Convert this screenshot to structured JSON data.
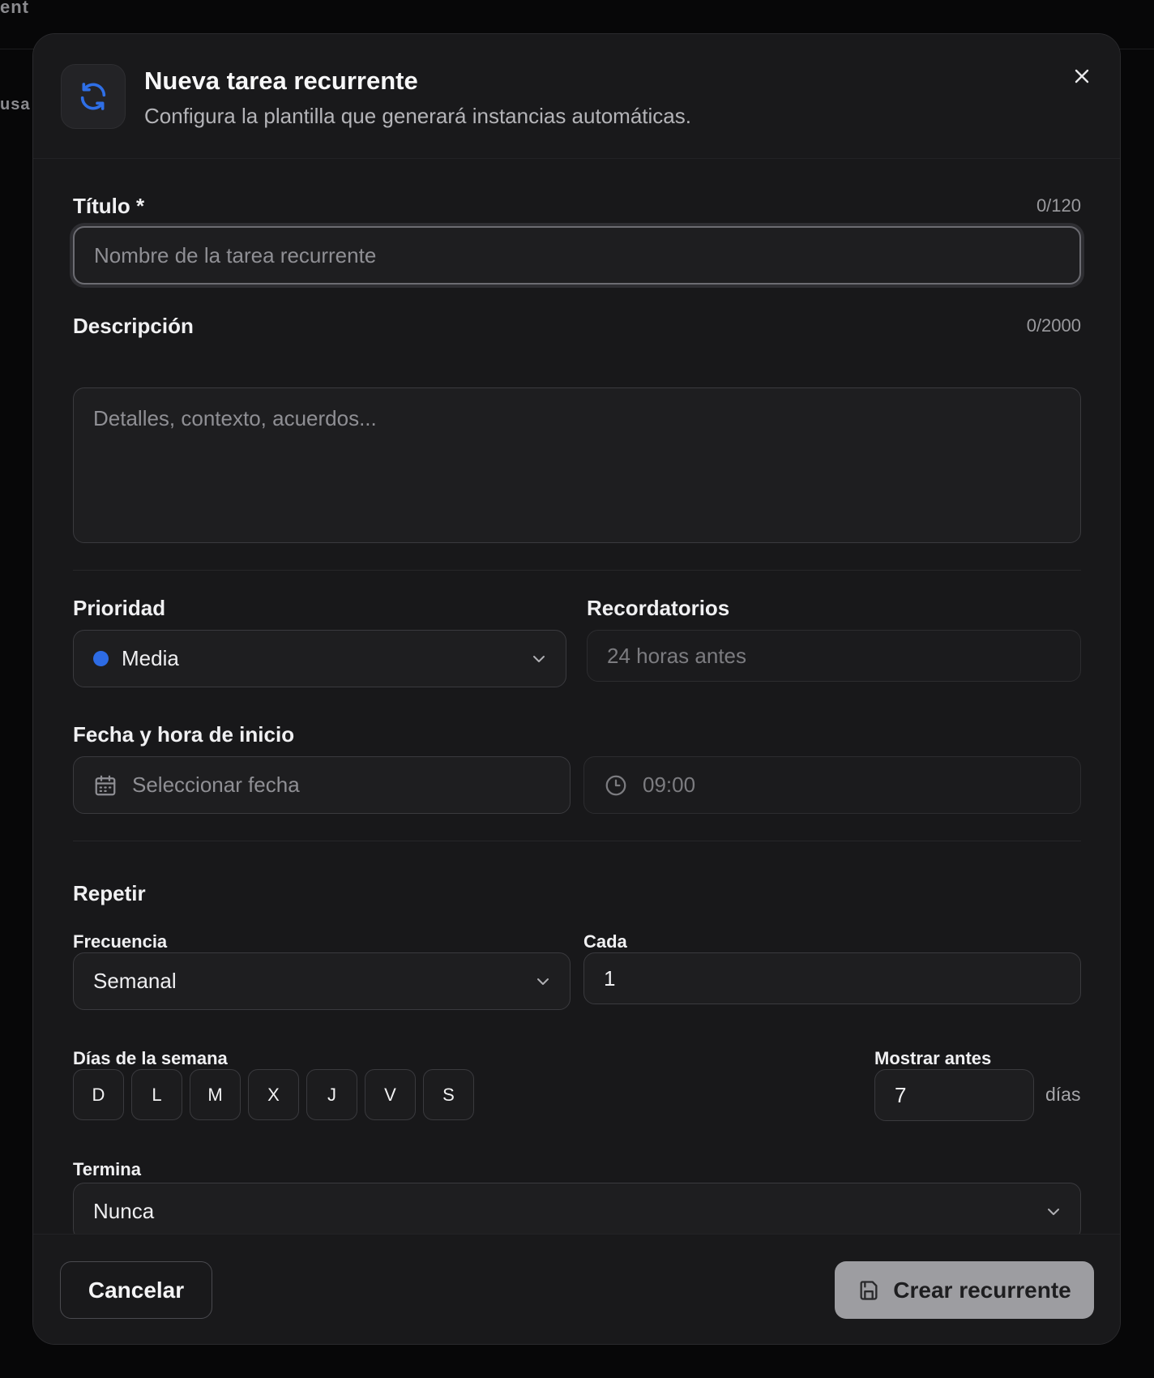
{
  "background": {
    "top_text": "ent",
    "side_text": "usa"
  },
  "modal": {
    "title": "Nueva tarea recurrente",
    "subtitle": "Configura la plantilla que generará instancias automáticas.",
    "icon": "refresh-icon",
    "accent_color": "#2f6fe6"
  },
  "form": {
    "title": {
      "label": "Título *",
      "counter": "0/120",
      "placeholder": "Nombre de la tarea recurrente",
      "value": ""
    },
    "description": {
      "label": "Descripción",
      "counter": "0/2000",
      "placeholder": "Detalles, contexto, acuerdos...",
      "value": ""
    },
    "priority": {
      "label": "Prioridad",
      "value": "Media",
      "dot_color": "#2d6be4"
    },
    "reminders": {
      "label": "Recordatorios",
      "placeholder": "24 horas antes"
    },
    "start": {
      "label": "Fecha y hora de inicio",
      "date_placeholder": "Seleccionar fecha",
      "time_placeholder": "09:00"
    },
    "repeat": {
      "section_label": "Repetir",
      "frequency": {
        "label": "Frecuencia",
        "value": "Semanal"
      },
      "every": {
        "label": "Cada",
        "value": "1"
      },
      "weekdays": {
        "label": "Días de la semana",
        "days": [
          "D",
          "L",
          "M",
          "X",
          "J",
          "V",
          "S"
        ]
      },
      "show_before": {
        "label": "Mostrar antes",
        "value": "7",
        "suffix": "días"
      },
      "ends": {
        "label": "Termina",
        "value": "Nunca"
      }
    }
  },
  "footer": {
    "cancel_label": "Cancelar",
    "create_label": "Crear recurrente"
  }
}
